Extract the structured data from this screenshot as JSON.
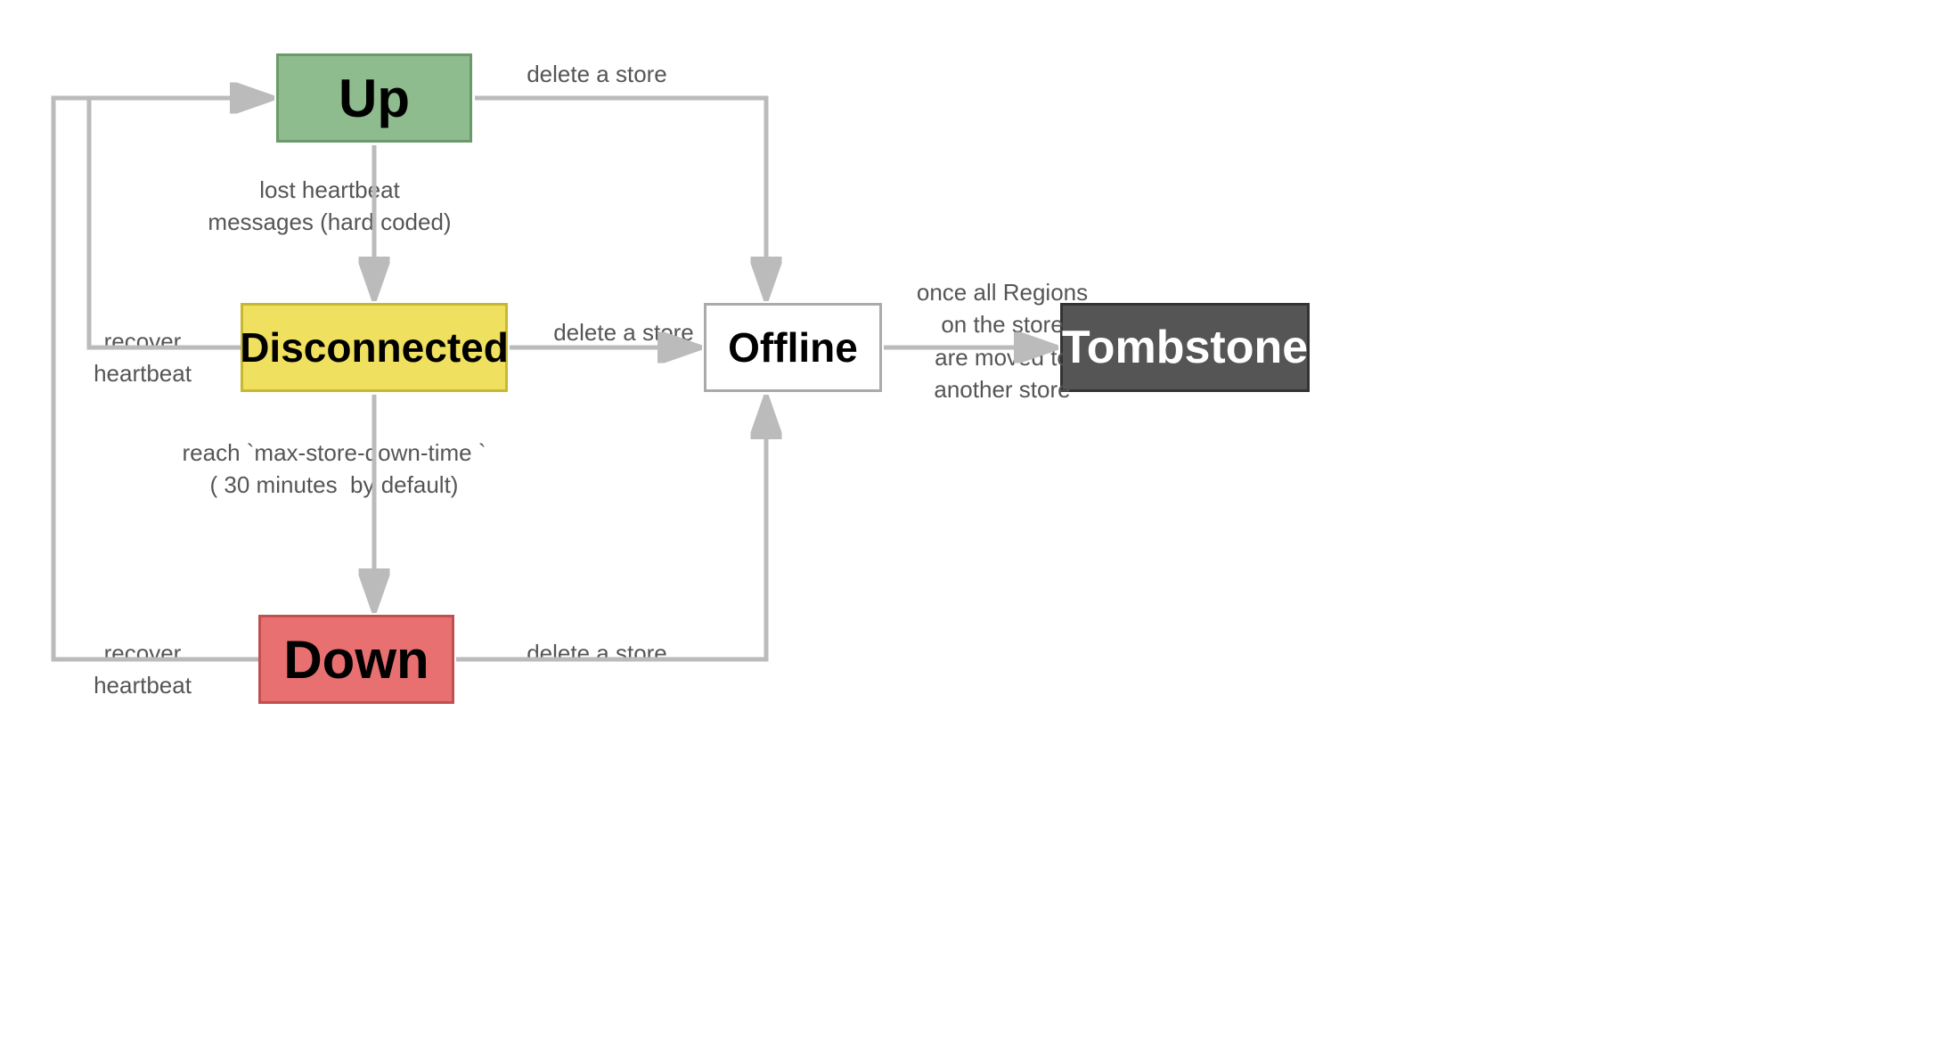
{
  "states": {
    "up": {
      "label": "Up"
    },
    "disconnected": {
      "label": "Disconnected"
    },
    "down": {
      "label": "Down"
    },
    "offline": {
      "label": "Offline"
    },
    "tombstone": {
      "label": "Tombstone"
    }
  },
  "transitions": {
    "up_to_disconnected": "lost heartbeat messages\n(hard coded)",
    "disconnected_to_down": "reach `max-store-down-time `\n( 30 minutes  by default)",
    "recover_heartbeat_disconnected": "recover\nheartbeat",
    "recover_heartbeat_down": "recover\nheartbeat",
    "delete_store_up": "delete a store",
    "delete_store_disconnected": "delete a store",
    "delete_store_down": "delete a store",
    "offline_to_tombstone": "once all Regions\non the store\nare moved to\nanother store"
  }
}
